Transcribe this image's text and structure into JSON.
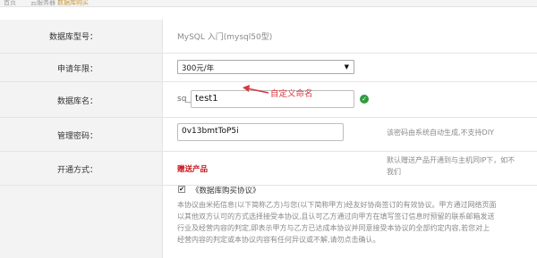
{
  "breadcrumb": [
    "首页",
    "云服务器",
    "数据库购买"
  ],
  "form": {
    "db_model": {
      "label": "数据库型号：",
      "value": "MySQL 入门(mysql50型)"
    },
    "term": {
      "label": "申请年限：",
      "selected": "300元/年"
    },
    "db_name": {
      "label": "数据库名：",
      "prefix": "sq_",
      "value": "test1"
    },
    "password": {
      "label": "管理密码：",
      "value": "0v13bmtToP5i",
      "hint": "该密码由系统自动生成,不支持DIY"
    },
    "open_method": {
      "label": "开通方式：",
      "value": "赠送产品",
      "hint_line1": "默认赠送产品开通到与主机同IP下，如不",
      "hint_line2": "我们"
    }
  },
  "annotation": {
    "text": "自定义命名"
  },
  "agreement": {
    "checked": true,
    "title": "《数据库购买协议》",
    "lines": [
      "本协议由米拓信息(以下简称乙方)与您(以下简称甲方)经友好协商签订的有效协议。甲方通过网络页面",
      "以其他双方认可的方式选择接受本协议,且认可乙方通过向甲方在填写签订信息时预留的联系邮箱发送",
      "行业及经营内容的判定,即表示甲方与乙方已达成本协议并同意接受本协议的全部约定内容,若您对上",
      "经营内容的判定或本协议内容有任何异议或不解,请勿点击确认。"
    ]
  },
  "colors": {
    "label_bg": "#f3f3f3",
    "red": "#c8141d",
    "annotation": "#d9363e",
    "ok_green": "#2e9d3e"
  }
}
